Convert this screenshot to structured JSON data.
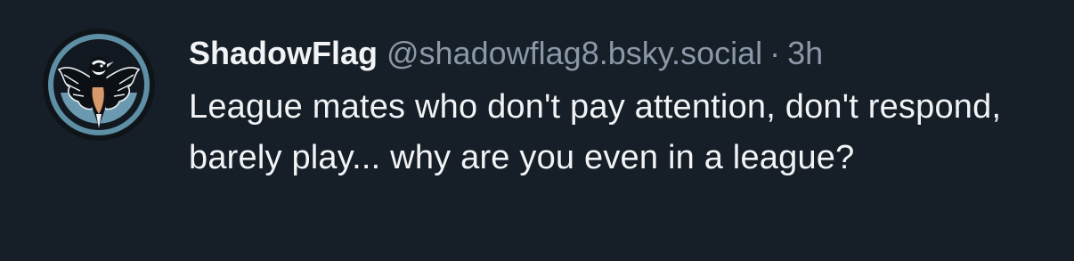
{
  "post": {
    "author": {
      "display_name": "ShadowFlag",
      "handle": "@shadowflag8.bsky.social"
    },
    "separator": "·",
    "timestamp": "3h",
    "text": "League mates who don't pay attention, don't respond, barely play... why are you even in a league?",
    "avatar_icon": "bird-avatar-icon"
  },
  "colors": {
    "background": "#161e27",
    "text_primary": "#f1f3f5",
    "text_secondary": "#8a98a8",
    "avatar_ring": "#5e8fa5"
  }
}
